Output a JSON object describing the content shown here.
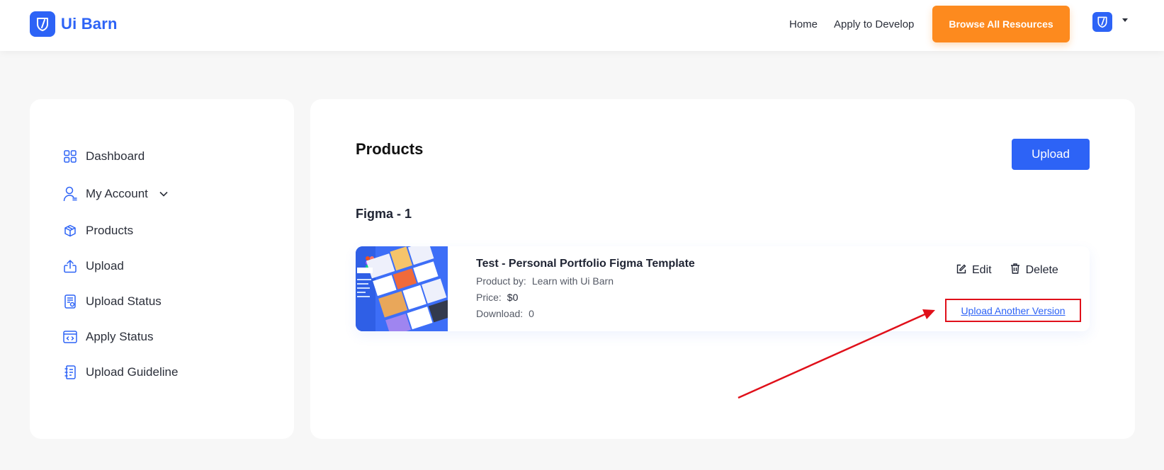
{
  "header": {
    "brand": "Ui Barn",
    "nav": [
      "Home",
      "Apply to Develop"
    ],
    "browse_label": "Browse All Resources",
    "brand_color": "#2d63f6",
    "cta_color": "#fd8a1e"
  },
  "sidebar": {
    "items": [
      {
        "label": "Dashboard",
        "icon": "grid-icon"
      },
      {
        "label": "My Account",
        "icon": "user-icon"
      },
      {
        "label": "Products",
        "icon": "box-icon"
      },
      {
        "label": "Upload",
        "icon": "upload-icon"
      },
      {
        "label": "Upload Status",
        "icon": "document-icon"
      },
      {
        "label": "Apply Status",
        "icon": "code-window-icon"
      },
      {
        "label": "Upload Guideline",
        "icon": "guideline-icon"
      }
    ]
  },
  "main": {
    "title": "Products",
    "upload_label": "Upload",
    "category": "Figma - 1",
    "product": {
      "title": "Test - Personal Portfolio Figma Template",
      "by_label": "Product by:",
      "by_value": "Learn with Ui Barn",
      "price_label": "Price:",
      "price_value": "$0",
      "download_label": "Download:",
      "download_value": "0",
      "edit_label": "Edit",
      "delete_label": "Delete",
      "another_label": "Upload Another Version"
    }
  },
  "annotation_color": "#e0101a"
}
